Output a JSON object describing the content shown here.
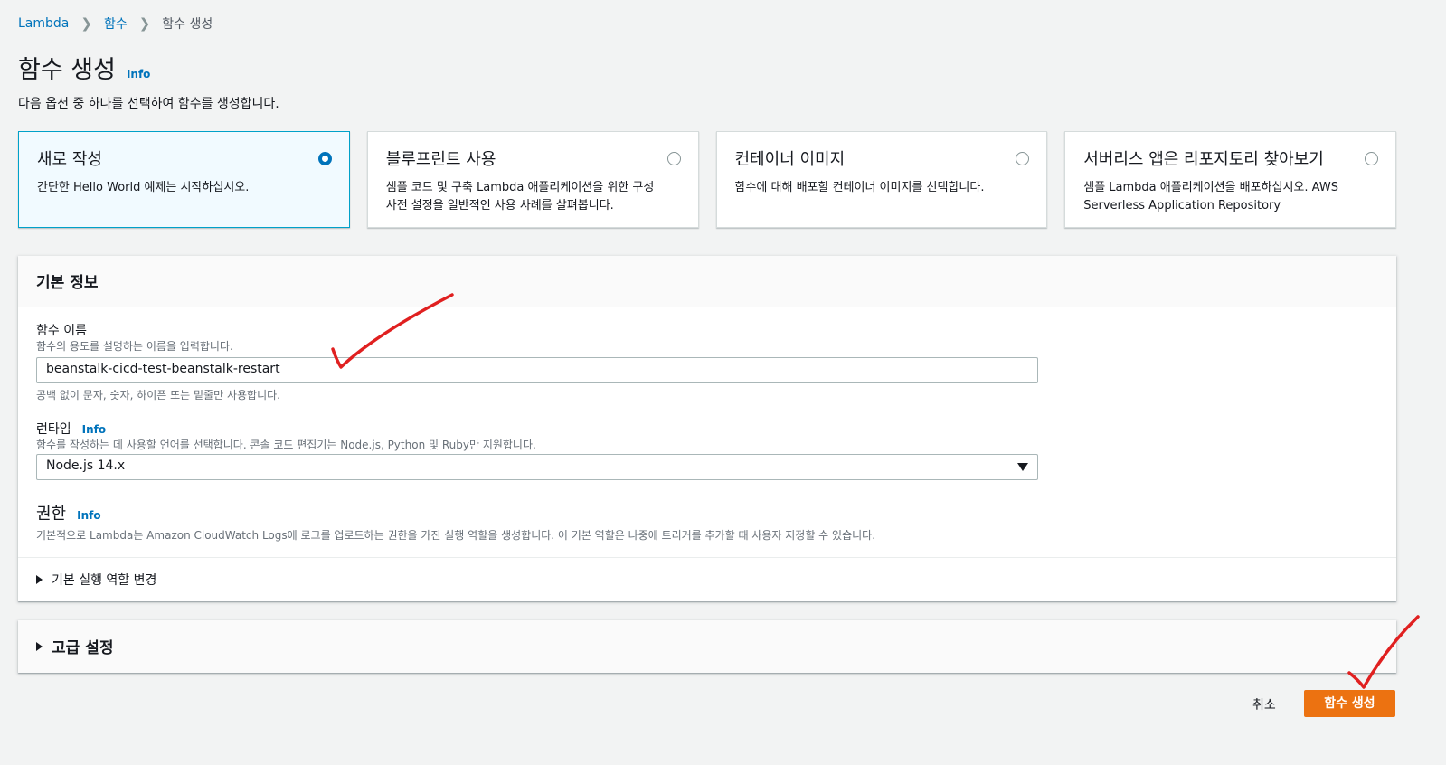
{
  "breadcrumb": [
    "Lambda",
    "함수",
    "함수 생성"
  ],
  "page": {
    "title": "함수 생성",
    "info": "Info",
    "subtitle": "다음 옵션 중 하나를 선택하여 함수를 생성합니다."
  },
  "options": [
    {
      "title": "새로 작성",
      "desc": "간단한 Hello World 예제는 시작하십시오.",
      "selected": true
    },
    {
      "title": "블루프린트 사용",
      "desc": "샘플 코드 및 구축 Lambda 애플리케이션을 위한 구성 사전 설정을 일반적인 사용 사례를 살펴봅니다.",
      "selected": false
    },
    {
      "title": "컨테이너 이미지",
      "desc": "함수에 대해 배포할 컨테이너 이미지를 선택합니다.",
      "selected": false
    },
    {
      "title": "서버리스 앱은 리포지토리 찾아보기",
      "desc": "샘플 Lambda 애플리케이션을 배포하십시오. AWS Serverless Application Repository",
      "selected": false
    }
  ],
  "basic": {
    "header": "기본 정보",
    "function_name": {
      "label": "함수 이름",
      "desc": "함수의 용도를 설명하는 이름을 입력합니다.",
      "value": "beanstalk-cicd-test-beanstalk-restart",
      "hint": "공백 없이 문자, 숫자, 하이픈 또는 밑줄만 사용합니다."
    },
    "runtime": {
      "label": "런타임",
      "info": "Info",
      "desc": "함수를 작성하는 데 사용할 언어를 선택합니다. 콘솔 코드 편집기는 Node.js, Python 및 Ruby만 지원합니다.",
      "value": "Node.js 14.x"
    },
    "permission": {
      "label": "권한",
      "info": "Info",
      "desc": "기본적으로 Lambda는 Amazon CloudWatch Logs에 로그를 업로드하는 권한을 가진 실행 역할을 생성합니다. 이 기본 역할은 나중에 트리거를 추가할 때 사용자 지정할 수 있습니다."
    },
    "role_expander": "기본 실행 역할 변경"
  },
  "advanced": {
    "header": "고급 설정"
  },
  "actions": {
    "cancel": "취소",
    "create": "함수 생성"
  },
  "colors": {
    "accent": "#ec7211",
    "link": "#0073bb",
    "selected_border": "#00a1c9",
    "annotation": "#e02020"
  }
}
